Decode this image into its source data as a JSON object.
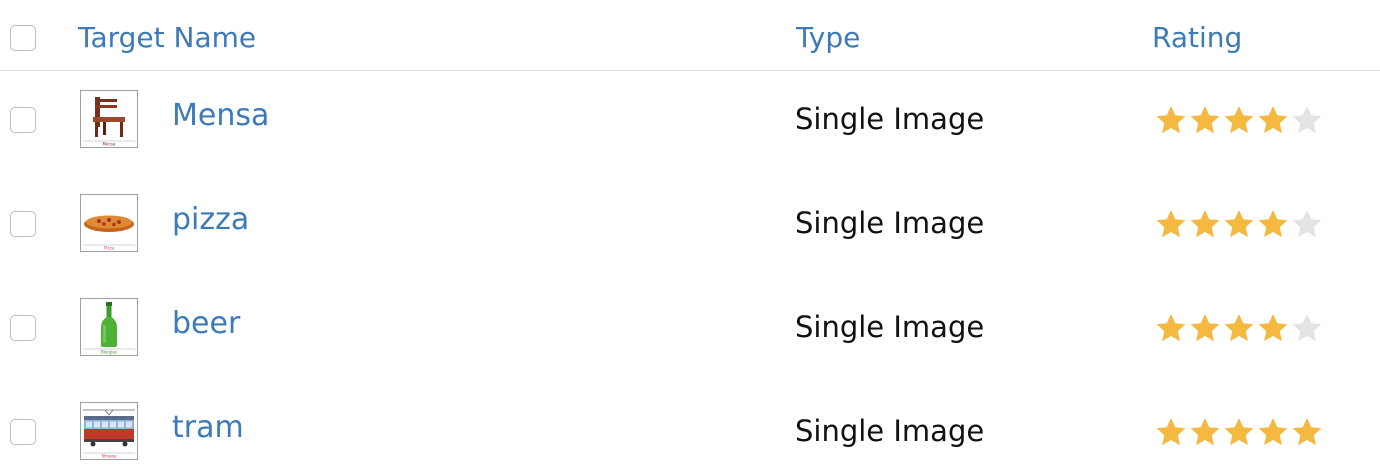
{
  "header": {
    "target_name_label": "Target Name",
    "type_label": "Type",
    "rating_label": "Rating"
  },
  "colors": {
    "link": "#3d7ab8",
    "star_filled": "#f5b942",
    "star_empty": "#e3e3e3"
  },
  "rows": [
    {
      "name": "Mensa",
      "thumb_icon": "chair-icon",
      "thumb_caption": "Mensa",
      "type": "Single Image",
      "rating": 4
    },
    {
      "name": "pizza",
      "thumb_icon": "pizza-icon",
      "thumb_caption": "Pizza",
      "type": "Single Image",
      "rating": 4
    },
    {
      "name": "beer",
      "thumb_icon": "beer-bottle-icon",
      "thumb_caption": "Bierglas",
      "type": "Single Image",
      "rating": 4
    },
    {
      "name": "tram",
      "thumb_icon": "tram-icon",
      "thumb_caption": "Strasse",
      "type": "Single Image",
      "rating": 5
    }
  ]
}
